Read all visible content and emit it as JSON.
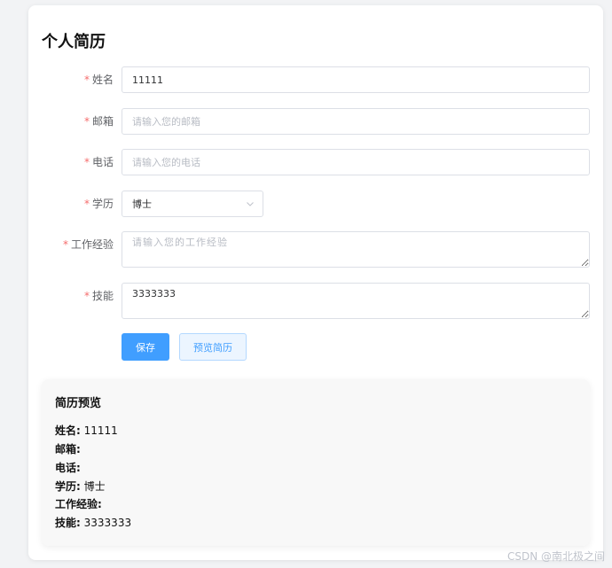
{
  "page": {
    "title": "个人简历"
  },
  "form": {
    "required_mark": "*",
    "name": {
      "label": "姓名",
      "value": "11111",
      "placeholder": ""
    },
    "email": {
      "label": "邮箱",
      "value": "",
      "placeholder": "请输入您的邮箱"
    },
    "phone": {
      "label": "电话",
      "value": "",
      "placeholder": "请输入您的电话"
    },
    "education": {
      "label": "学历",
      "value": "博士"
    },
    "experience": {
      "label": "工作经验",
      "value": "",
      "placeholder": "请输入您的工作经验"
    },
    "skills": {
      "label": "技能",
      "value": "3333333",
      "placeholder": ""
    }
  },
  "buttons": {
    "save": "保存",
    "preview": "预览简历"
  },
  "preview": {
    "title": "简历预览",
    "lines": [
      {
        "key": "姓名:",
        "value": "11111"
      },
      {
        "key": "邮箱:",
        "value": ""
      },
      {
        "key": "电话:",
        "value": ""
      },
      {
        "key": "学历:",
        "value": "博士"
      },
      {
        "key": "工作经验:",
        "value": ""
      },
      {
        "key": "技能:",
        "value": "3333333"
      }
    ]
  },
  "watermark": "CSDN @南北极之间",
  "colors": {
    "primary": "#409eff",
    "required": "#f56c6c",
    "border": "#dcdfe6"
  },
  "icons": {
    "select_arrow": "chevron-down-icon"
  }
}
